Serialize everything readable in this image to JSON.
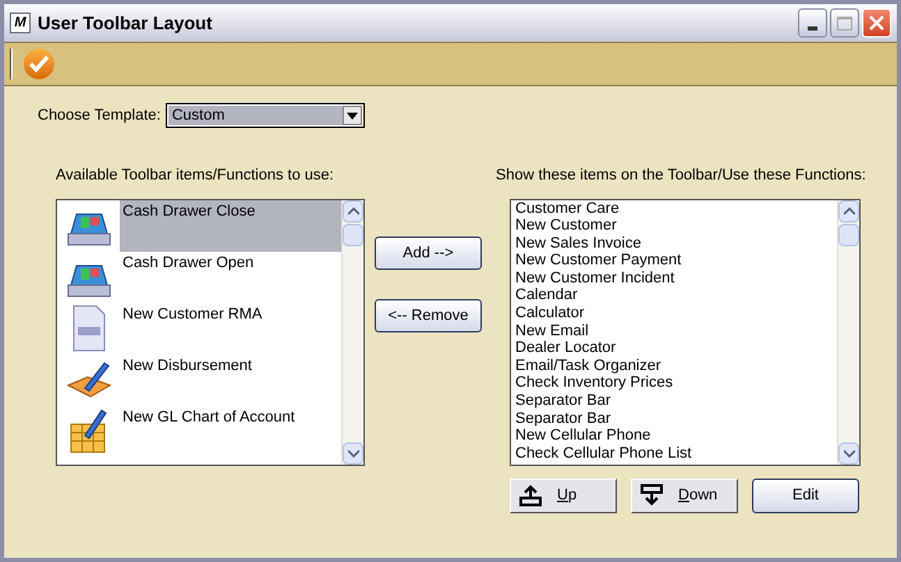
{
  "window": {
    "title": "User Toolbar Layout",
    "app_badge": "M"
  },
  "template": {
    "label": "Choose Template:",
    "value": "Custom"
  },
  "available": {
    "label": "Available Toolbar items/Functions to use:",
    "items": [
      {
        "label": "Cash Drawer Close",
        "kind": "register",
        "selected": true
      },
      {
        "label": "Cash Drawer Open",
        "kind": "register",
        "selected": false
      },
      {
        "label": "New Customer RMA",
        "kind": "document",
        "selected": false
      },
      {
        "label": "New Disbursement",
        "kind": "writing",
        "selected": false
      },
      {
        "label": "New GL Chart of Account",
        "kind": "ledger",
        "selected": false
      }
    ]
  },
  "middle_buttons": [
    "Add -->",
    "<-- Remove"
  ],
  "shown": {
    "label": "Show these items on the Toolbar/Use these Functions:",
    "items": [
      "Customer Care",
      "New Customer",
      "New Sales Invoice",
      "New Customer Payment",
      "New Customer Incident",
      "Calendar",
      "Calculator",
      "New Email",
      "Dealer Locator",
      "Email/Task Organizer",
      "Check Inventory Prices",
      "Separator Bar",
      "Separator Bar",
      "New Cellular Phone",
      "Check Cellular Phone List"
    ]
  },
  "bottom_buttons": [
    {
      "label": "Up",
      "kind": "up"
    },
    {
      "label": "Down",
      "kind": "down"
    },
    {
      "label": "Edit",
      "kind": "plain"
    }
  ]
}
